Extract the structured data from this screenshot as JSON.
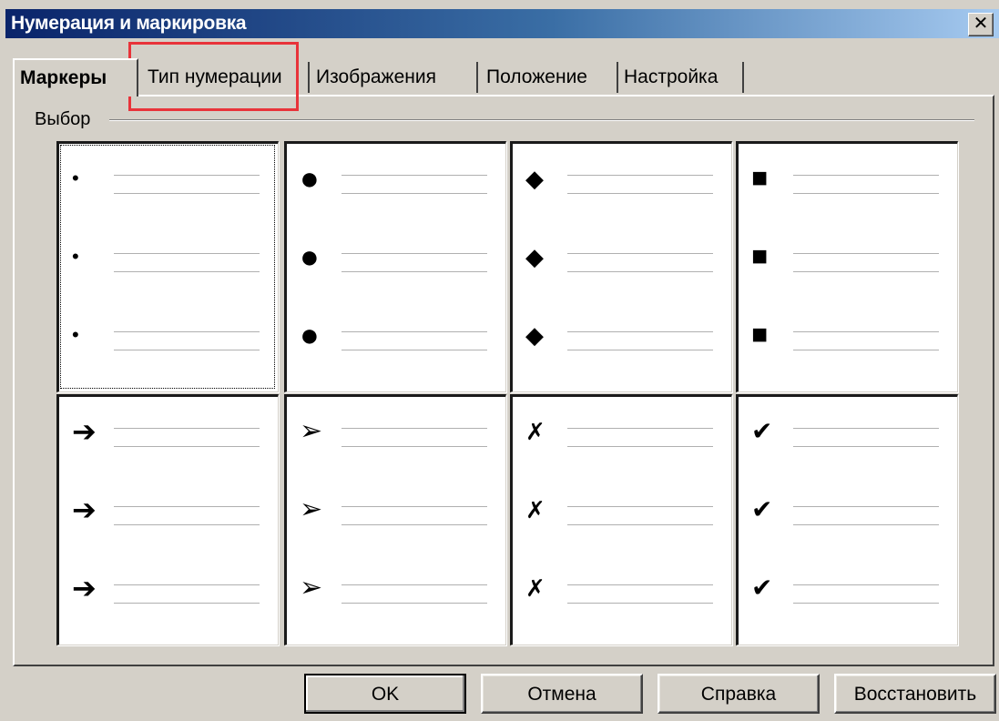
{
  "window": {
    "title": "Нумерация и маркировка",
    "close_glyph": "✕"
  },
  "tabs": [
    {
      "label": "Маркеры",
      "active": true
    },
    {
      "label": "Тип нумерации",
      "active": false
    },
    {
      "label": "Изображения",
      "active": false
    },
    {
      "label": "Положение",
      "active": false
    },
    {
      "label": "Настройка",
      "active": false
    }
  ],
  "group": {
    "label": "Выбор"
  },
  "bullet_styles": [
    {
      "name": "small-dot",
      "glyph": "•"
    },
    {
      "name": "large-dot",
      "glyph": "●"
    },
    {
      "name": "diamond",
      "glyph": "◆"
    },
    {
      "name": "square",
      "glyph": "■"
    },
    {
      "name": "arrow",
      "glyph": "➔"
    },
    {
      "name": "arrowhead",
      "glyph": "➢"
    },
    {
      "name": "cross",
      "glyph": "✗"
    },
    {
      "name": "check",
      "glyph": "✔"
    }
  ],
  "buttons": {
    "ok": "OK",
    "cancel": "Отмена",
    "help": "Справка",
    "restore": "Восстановить"
  }
}
